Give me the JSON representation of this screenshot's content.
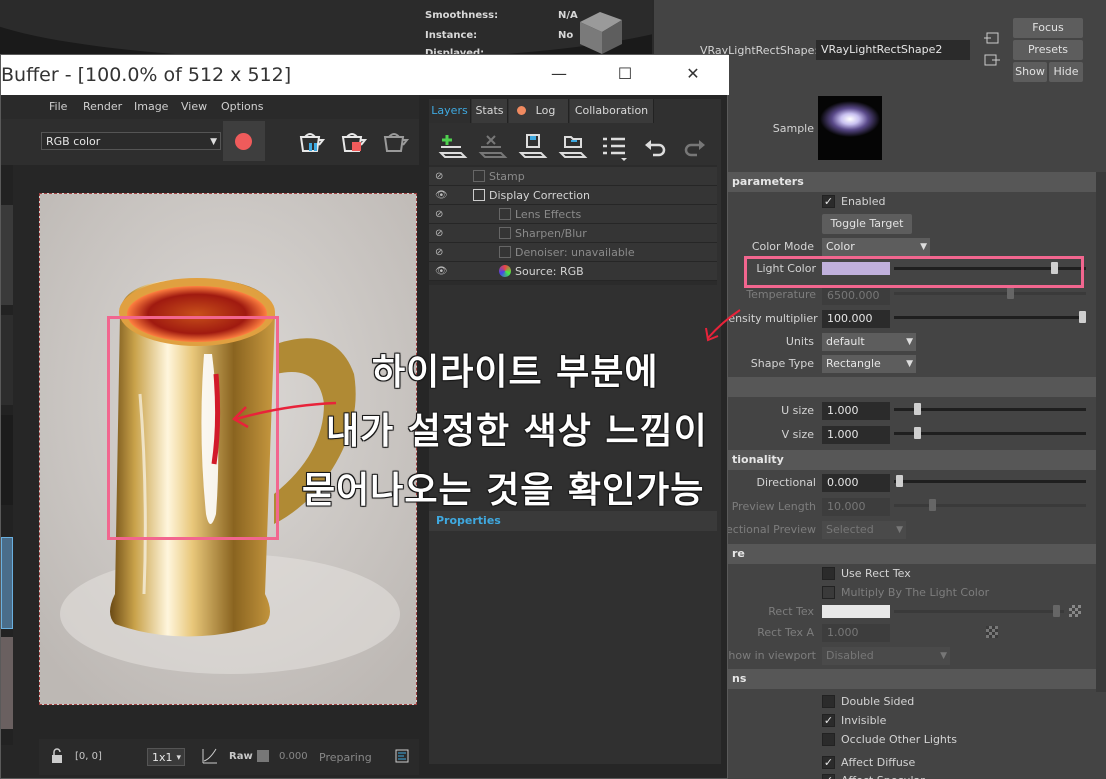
{
  "maya_hud": {
    "smoothness_label": "Smoothness:",
    "smoothness_value": "N/A",
    "instance_label": "Instance:",
    "instance_value": "No",
    "displayed_label": "Displayed:"
  },
  "attribute_editor": {
    "node_label": "VRayLightRectShape:",
    "node_value": "VRayLightRectShape2",
    "focus_button": "Focus",
    "presets_button": "Presets",
    "show_button": "Show",
    "hide_button": "Hide",
    "sample_label": "Sample",
    "sections": {
      "parameters": "parameters",
      "directionality": "tionality",
      "texture": "re",
      "options": "ns"
    },
    "enabled_label": "Enabled",
    "toggle_target_button": "Toggle Target",
    "color_mode_label": "Color Mode",
    "color_mode_value": "Color",
    "light_color_label": "Light Color",
    "light_color_hex": "#c0b0dc",
    "temperature_label": "Temperature",
    "temperature_value": "6500.000",
    "intensity_label": "tensity multiplier",
    "intensity_value": "100.000",
    "units_label": "Units",
    "units_value": "default",
    "shape_type_label": "Shape Type",
    "shape_type_value": "Rectangle",
    "u_size_label": "U size",
    "u_size_value": "1.000",
    "v_size_label": "V size",
    "v_size_value": "1.000",
    "directional_label": "Directional",
    "directional_value": "0.000",
    "preview_length_label": "Preview Length",
    "preview_length_value": "10.000",
    "directional_preview_label": "ectional Preview",
    "directional_preview_value": "Selected",
    "use_rect_tex_label": "Use Rect Tex",
    "multiply_label": "Multiply By The Light Color",
    "rect_tex_label": "Rect Tex",
    "rect_tex_a_label": "Rect Tex A",
    "rect_tex_a_value": "1.000",
    "show_in_viewport_label": "how in viewport",
    "show_in_viewport_value": "Disabled",
    "double_sided_label": "Double Sided",
    "invisible_label": "Invisible",
    "occlude_label": "Occlude Other Lights",
    "affect_diffuse_label": "Affect Diffuse",
    "affect_specular_label": "Affect Specular"
  },
  "vfb": {
    "title": "Buffer - [100.0% of 512 x 512]",
    "menu": [
      "File",
      "Render",
      "Image",
      "View",
      "Options"
    ],
    "channel_value": "RGB color",
    "tabs": [
      "Layers",
      "Stats",
      "Log",
      "Collaboration"
    ],
    "layers": [
      {
        "name": "Stamp",
        "visible": false
      },
      {
        "name": "Display Correction",
        "visible": true
      },
      {
        "name": "Lens Effects",
        "visible": false
      },
      {
        "name": "Sharpen/Blur",
        "visible": false
      },
      {
        "name": "Denoiser: unavailable",
        "visible": false
      },
      {
        "name": "Source: RGB",
        "visible": true
      }
    ],
    "properties_label": "Properties",
    "coords": "[0, 0]",
    "zoom_value": "1x1",
    "raw_label": "Raw",
    "raw_value": "0.000",
    "status": "Preparing"
  },
  "annotation": {
    "line1": "하이라이트 부분에",
    "line2": "내가 설정한 색상 느낌이",
    "line3": "묻어나오는 것을 확인가능",
    "color": "#f2668f"
  }
}
